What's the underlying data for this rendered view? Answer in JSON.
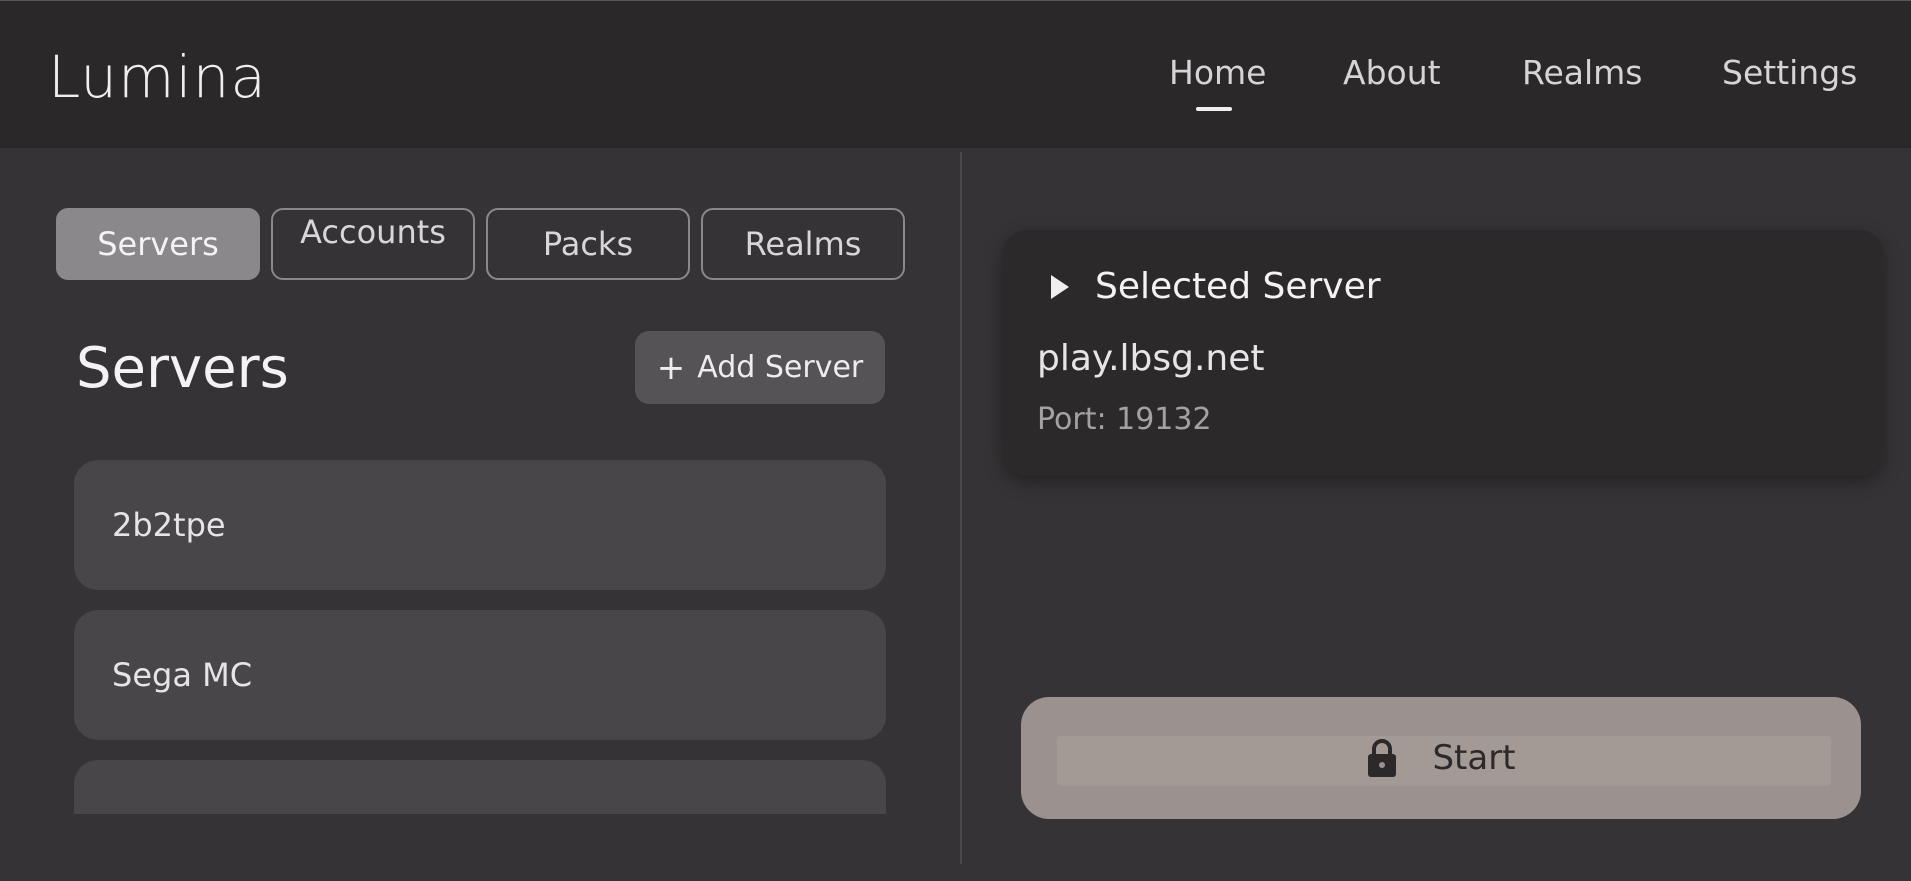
{
  "app": {
    "title": "Lumina"
  },
  "nav": {
    "items": [
      {
        "label": "Home",
        "active": true
      },
      {
        "label": "About"
      },
      {
        "label": "Realms"
      },
      {
        "label": "Settings"
      }
    ]
  },
  "tabs": [
    {
      "label": "Servers",
      "active": true
    },
    {
      "label": "Accounts"
    },
    {
      "label": "Packs"
    },
    {
      "label": "Realms"
    }
  ],
  "servers": {
    "title": "Servers",
    "add_label": "Add Server",
    "items": [
      {
        "name": "2b2tpe"
      },
      {
        "name": "Sega MC"
      },
      {
        "name": ""
      }
    ]
  },
  "selected": {
    "title": "Selected Server",
    "address": "play.lbsg.net",
    "port_text": "Port: 19132"
  },
  "start": {
    "label": "Start"
  },
  "colors": {
    "background": "#353335",
    "topbar": "#2a2829",
    "start_button": "#9b918e"
  },
  "icons": {
    "add": "plus-icon",
    "play": "play-triangle-icon",
    "lock": "lock-icon"
  }
}
